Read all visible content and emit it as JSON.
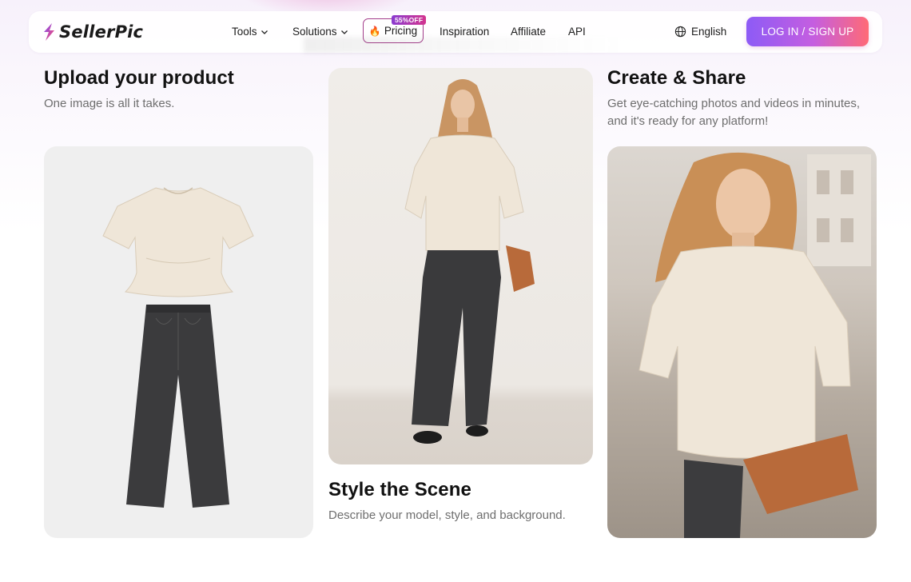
{
  "header": {
    "brand": "SellerPic",
    "nav": {
      "tools": "Tools",
      "solutions": "Solutions",
      "pricing": "Pricing",
      "pricing_badge": "55%OFF",
      "inspiration": "Inspiration",
      "affiliate": "Affiliate",
      "api": "API"
    },
    "language": "English",
    "login": "LOG IN / SIGN UP"
  },
  "steps": {
    "upload": {
      "title": "Upload your product",
      "description": "One image is all it takes."
    },
    "style": {
      "title": "Style the Scene",
      "description": "Describe your model, style, and background."
    },
    "share": {
      "title": "Create & Share",
      "description": "Get eye-catching photos and videos in minutes, and it's ready for any platform!"
    }
  },
  "colors": {
    "accent_start": "#8d5bf6",
    "accent_end": "#ff6a76",
    "pricing_border": "#a33c8a",
    "blouse": "#efe6d8",
    "jeans": "#3a3a3a",
    "bag": "#b86a3a"
  },
  "icons": {
    "logo": "lightning-s-logo",
    "fire": "fire-icon",
    "chevron": "chevron-down-icon",
    "globe": "globe-icon"
  }
}
